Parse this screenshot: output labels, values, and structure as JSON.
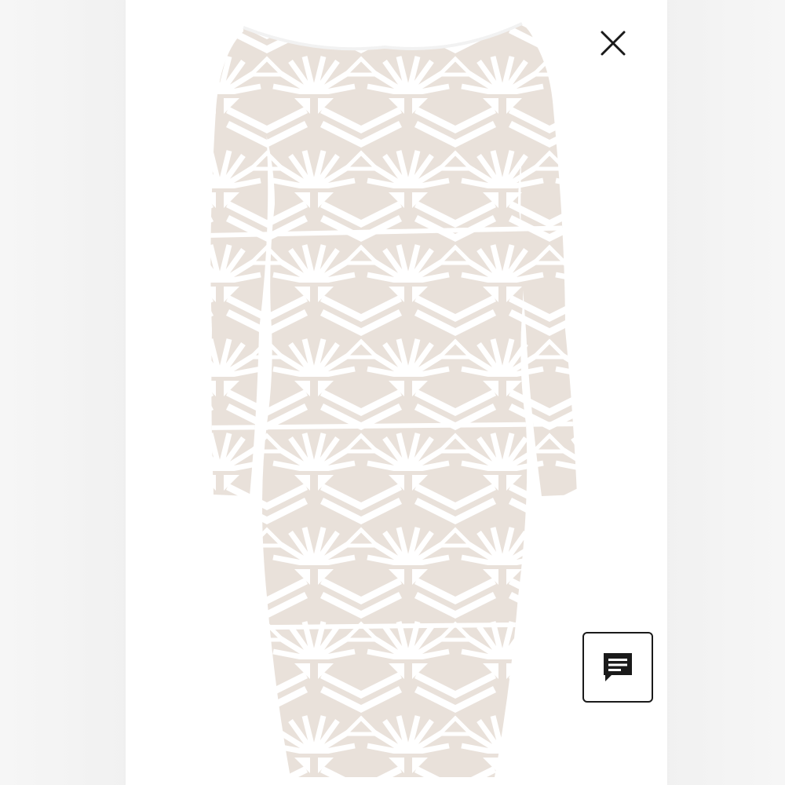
{
  "viewer": {
    "product_image": {
      "icon": "dress-photo",
      "dress_color": "#ffffff",
      "lining_color": "#e9e1da"
    },
    "close_button": {
      "icon": "close-icon",
      "color": "#1a1a1a"
    },
    "chat_button": {
      "icon": "chat-icon",
      "color": "#1a1a1a"
    }
  }
}
